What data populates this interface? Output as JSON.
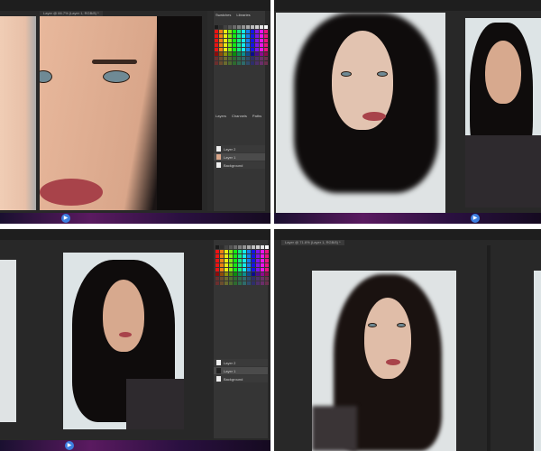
{
  "panels": {
    "swatches": "Swatches",
    "libraries": "Libraries",
    "layers": "Layers",
    "channels": "Channels",
    "paths": "Paths"
  },
  "layers": [
    {
      "name": "Layer 2"
    },
    {
      "name": "Layer 1"
    },
    {
      "name": "Background"
    }
  ],
  "doc_tabs": {
    "q1": "Layer @ 66.7% (Layer 1, RGB/8) *",
    "q4": "Layer @ 71.6% (Layer 1, RGB/8) *"
  },
  "colors": {
    "accent": "#3c7ee0",
    "taskbar": "#5a1a60"
  }
}
